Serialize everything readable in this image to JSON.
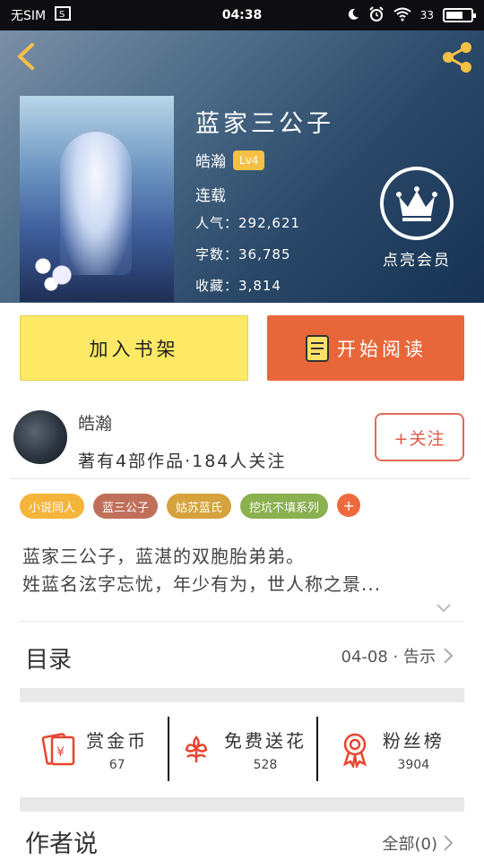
{
  "status_bar": {
    "sim": "无SIM",
    "time": "04:38",
    "battery": "33"
  },
  "book": {
    "title": "蓝家三公子",
    "author": "皓瀚",
    "level": "Lv4",
    "status": "连载",
    "popularity_label": "人气：",
    "popularity": "292,621",
    "words_label": "字数：",
    "words": "36,785",
    "favorites_label": "收藏：",
    "favorites": "3,814"
  },
  "vip": {
    "label": "点亮会员"
  },
  "buttons": {
    "add_shelf": "加入书架",
    "start_reading": "开始阅读"
  },
  "author_card": {
    "name": "皓瀚",
    "meta": "著有4部作品·184人关注",
    "follow": "+关注"
  },
  "tags": [
    {
      "label": "小说同人",
      "color": "#f5b53a"
    },
    {
      "label": "蓝三公子",
      "color": "#c0705a"
    },
    {
      "label": "姑苏蓝氏",
      "color": "#d6a23c"
    },
    {
      "label": "挖坑不填系列",
      "color": "#8ab050"
    }
  ],
  "tag_more": "+",
  "summary": {
    "line1": "蓝家三公子，蓝湛的双胞胎弟弟。",
    "line2": "姓蓝名泫字忘忧，年少有为，世人称之景..."
  },
  "toc": {
    "title": "目录",
    "latest": "04-08 · 告示"
  },
  "actions": [
    {
      "label": "赏金币",
      "count": "67",
      "icon": "red-envelope-icon"
    },
    {
      "label": "免费送花",
      "count": "528",
      "icon": "flower-icon"
    },
    {
      "label": "粉丝榜",
      "count": "3904",
      "icon": "medal-icon"
    }
  ],
  "author_says": {
    "title": "作者说",
    "all": "全部(0)"
  },
  "colors": {
    "accent_orange": "#e8673a",
    "shelf_yellow": "#fde966",
    "follow_red": "#e0574a"
  }
}
